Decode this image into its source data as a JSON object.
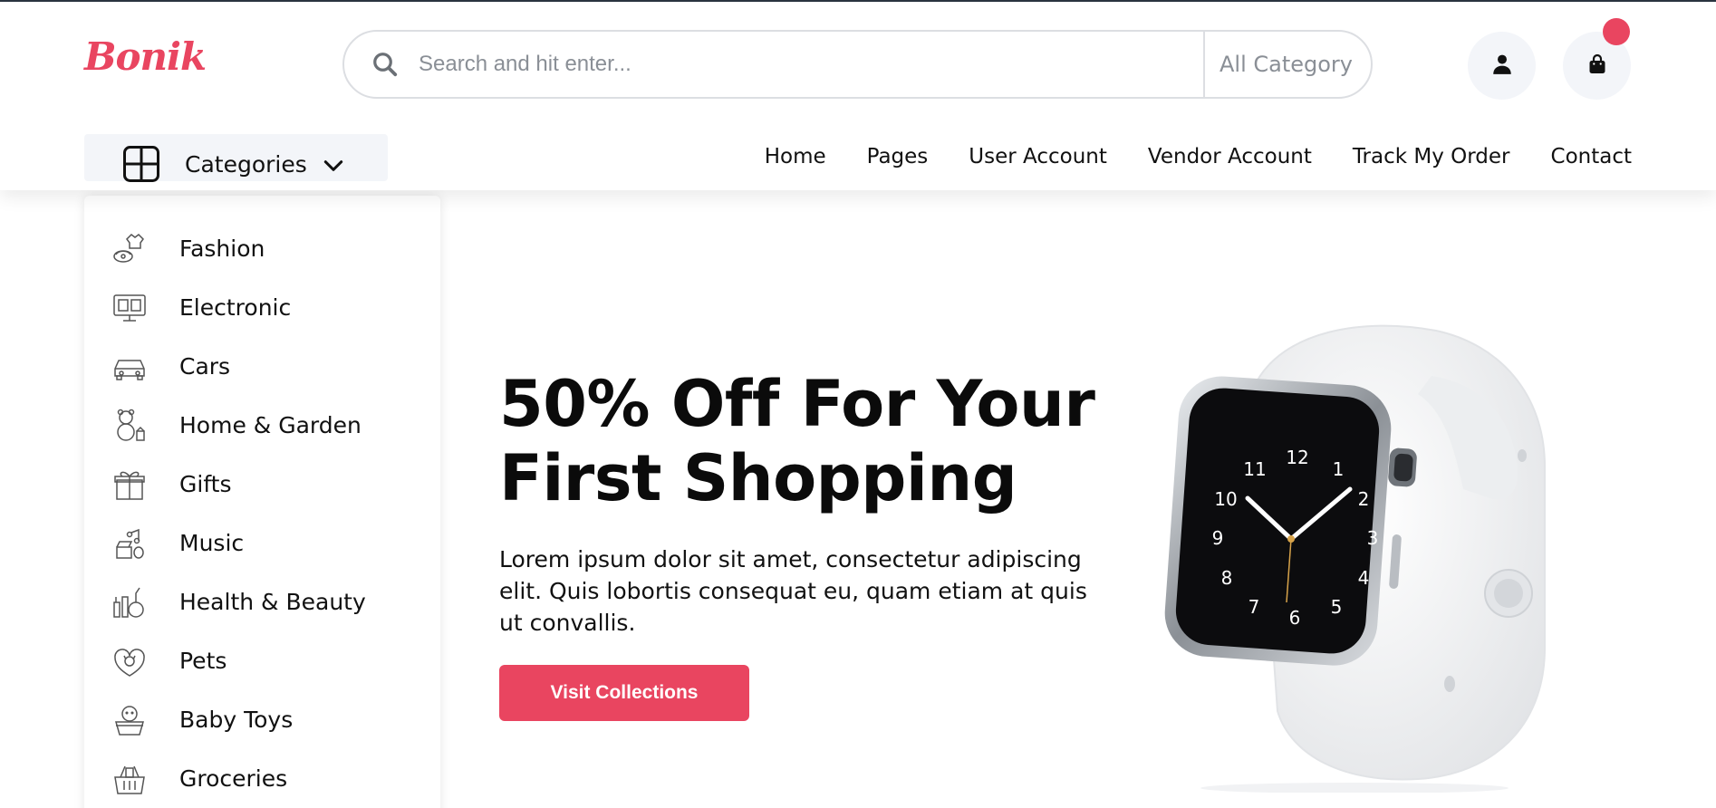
{
  "brand": {
    "logo_text": "Bonik",
    "accent_color": "#e94560"
  },
  "search": {
    "placeholder": "Search and hit enter...",
    "value": "",
    "category": "All Category",
    "icon": "search-icon"
  },
  "header_actions": [
    {
      "name": "user",
      "icon": "user-icon"
    },
    {
      "name": "cart",
      "icon": "shopping-bag-icon",
      "badge": ""
    }
  ],
  "categories_toggle": {
    "label": "Categories",
    "icon": "grid-icon",
    "chevron": "chevron-down-icon"
  },
  "nav": {
    "items": [
      "Home",
      "Pages",
      "User Account",
      "Vendor Account",
      "Track My Order",
      "Contact"
    ]
  },
  "sidebar": {
    "items": [
      {
        "label": "Fashion",
        "icon": "fashion-icon"
      },
      {
        "label": "Electronic",
        "icon": "electronic-icon"
      },
      {
        "label": "Cars",
        "icon": "car-icon"
      },
      {
        "label": "Home & Garden",
        "icon": "teddy-bear-icon"
      },
      {
        "label": "Gifts",
        "icon": "gift-icon"
      },
      {
        "label": "Music",
        "icon": "music-icon"
      },
      {
        "label": "Health & Beauty",
        "icon": "beauty-icon"
      },
      {
        "label": "Pets",
        "icon": "pet-icon"
      },
      {
        "label": "Baby Toys",
        "icon": "baby-icon"
      },
      {
        "label": "Groceries",
        "icon": "grocery-basket-icon"
      }
    ]
  },
  "hero": {
    "title_line1": "50% Off For Your",
    "title_line2": "First Shopping",
    "text": "Lorem ipsum dolor sit amet, consectetur adipiscing elit. Quis lobortis consequat eu, quam etiam at quis ut convallis.",
    "button_label": "Visit Collections",
    "image": "smartwatch-image"
  }
}
